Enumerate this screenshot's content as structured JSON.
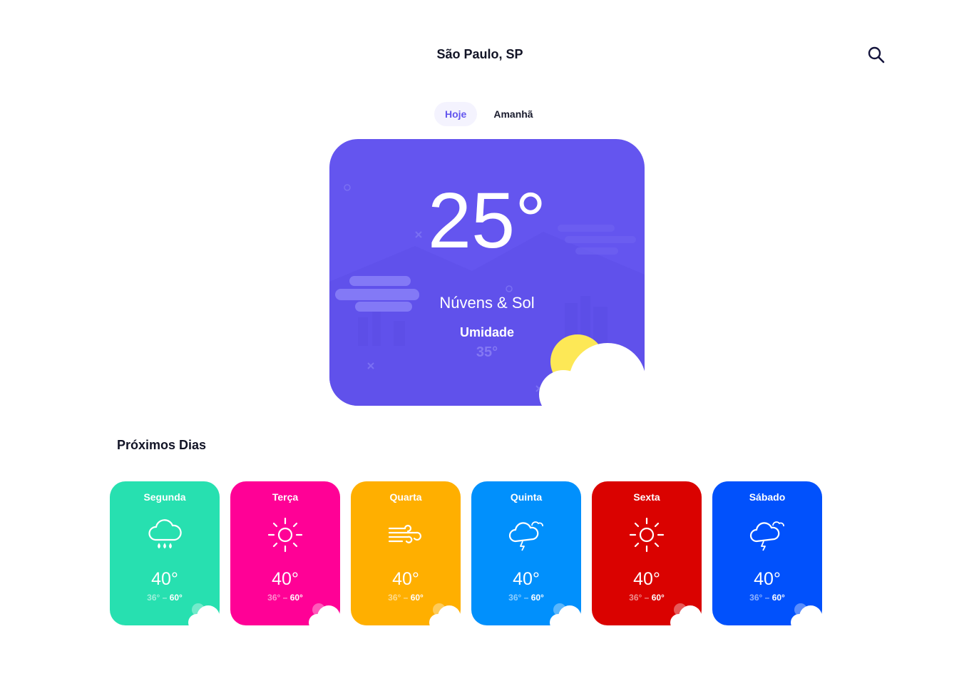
{
  "header": {
    "city": "São Paulo, SP",
    "search_icon": "search-icon"
  },
  "tabs": [
    {
      "label": "Hoje",
      "active": true
    },
    {
      "label": "Amanhã",
      "active": false
    }
  ],
  "current": {
    "temperature": "25°",
    "condition": "Núvens & Sol",
    "humidity_label": "Umidade",
    "humidity_value": "35°",
    "card_color": "#6455ef"
  },
  "forecast": {
    "title": "Próximos Dias",
    "days": [
      {
        "name": "Segunda",
        "icon": "cloud-rain-icon",
        "temp": "40°",
        "min": "36°",
        "sep": "–",
        "max": "60°",
        "color": "#27e0b0"
      },
      {
        "name": "Terça",
        "icon": "sun-icon",
        "temp": "40°",
        "min": "36°",
        "sep": "–",
        "max": "60°",
        "color": "#ff0196"
      },
      {
        "name": "Quarta",
        "icon": "wind-icon",
        "temp": "40°",
        "min": "36°",
        "sep": "–",
        "max": "60°",
        "color": "#ffaf00"
      },
      {
        "name": "Quinta",
        "icon": "cloud-lightning-icon",
        "temp": "40°",
        "min": "36°",
        "sep": "–",
        "max": "60°",
        "color": "#0190fc"
      },
      {
        "name": "Sexta",
        "icon": "sun-icon",
        "temp": "40°",
        "min": "36°",
        "sep": "–",
        "max": "60°",
        "color": "#da0200"
      },
      {
        "name": "Sábado",
        "icon": "cloud-lightning-icon",
        "temp": "40°",
        "min": "36°",
        "sep": "–",
        "max": "60°",
        "color": "#0151fc"
      }
    ]
  }
}
